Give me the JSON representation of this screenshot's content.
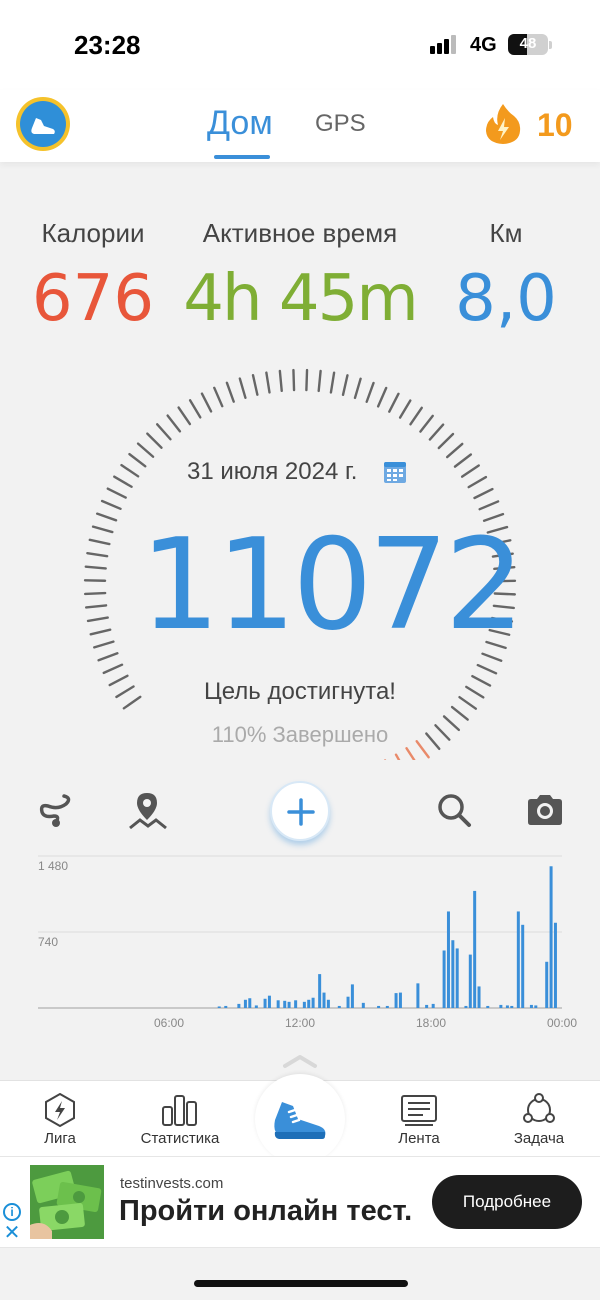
{
  "status_bar": {
    "time": "23:28",
    "network": "4G",
    "battery": "48",
    "battery_level": 0.48
  },
  "top_nav": {
    "tabs": [
      "Дом",
      "GPS"
    ],
    "active_tab": "Дом",
    "streak_count": "10",
    "accent": "#3a8fd9",
    "streak_color": "#f39a1d"
  },
  "stats": {
    "calories_label": "Калории",
    "calories_value": "676",
    "active_label": "Активное время",
    "active_value": "4h 45m",
    "distance_label": "Км",
    "distance_value": "8,0",
    "colors": {
      "calories": "#e8563a",
      "active": "#7fae35",
      "distance": "#3a8fd9"
    }
  },
  "dial": {
    "date": "31 июля 2024 г.",
    "steps": "11072",
    "goal_text": "Цель достигнута!",
    "percent_text": "110% Завершено",
    "progress": 1.1
  },
  "toolbar": {
    "icons": [
      "route-icon",
      "map-pin-icon",
      "plus-icon",
      "search-icon",
      "camera-icon"
    ]
  },
  "chart_data": {
    "type": "bar",
    "x_tick_labels": [
      "06:00",
      "12:00",
      "18:00",
      "00:00"
    ],
    "y_tick_labels": [
      "1 480",
      "740"
    ],
    "ylim": [
      0,
      1480
    ],
    "xlim": [
      0,
      24
    ],
    "color": "#3a8fd9",
    "bars": [
      {
        "x": 8.3,
        "y": 15
      },
      {
        "x": 8.6,
        "y": 20
      },
      {
        "x": 9.2,
        "y": 40
      },
      {
        "x": 9.5,
        "y": 80
      },
      {
        "x": 9.7,
        "y": 95
      },
      {
        "x": 10.0,
        "y": 25
      },
      {
        "x": 10.4,
        "y": 90
      },
      {
        "x": 10.6,
        "y": 120
      },
      {
        "x": 11.0,
        "y": 75
      },
      {
        "x": 11.3,
        "y": 70
      },
      {
        "x": 11.5,
        "y": 60
      },
      {
        "x": 11.8,
        "y": 75
      },
      {
        "x": 12.2,
        "y": 60
      },
      {
        "x": 12.4,
        "y": 80
      },
      {
        "x": 12.6,
        "y": 100
      },
      {
        "x": 12.9,
        "y": 330
      },
      {
        "x": 13.1,
        "y": 150
      },
      {
        "x": 13.3,
        "y": 80
      },
      {
        "x": 13.8,
        "y": 20
      },
      {
        "x": 14.2,
        "y": 110
      },
      {
        "x": 14.4,
        "y": 230
      },
      {
        "x": 14.9,
        "y": 50
      },
      {
        "x": 15.6,
        "y": 20
      },
      {
        "x": 16.0,
        "y": 20
      },
      {
        "x": 16.4,
        "y": 145
      },
      {
        "x": 16.6,
        "y": 150
      },
      {
        "x": 17.4,
        "y": 240
      },
      {
        "x": 17.8,
        "y": 30
      },
      {
        "x": 18.1,
        "y": 40
      },
      {
        "x": 18.6,
        "y": 560
      },
      {
        "x": 18.8,
        "y": 940
      },
      {
        "x": 19.0,
        "y": 660
      },
      {
        "x": 19.2,
        "y": 580
      },
      {
        "x": 19.6,
        "y": 20
      },
      {
        "x": 19.8,
        "y": 520
      },
      {
        "x": 20.0,
        "y": 1140
      },
      {
        "x": 20.2,
        "y": 210
      },
      {
        "x": 20.6,
        "y": 20
      },
      {
        "x": 21.2,
        "y": 30
      },
      {
        "x": 21.5,
        "y": 25
      },
      {
        "x": 21.7,
        "y": 20
      },
      {
        "x": 22.0,
        "y": 940
      },
      {
        "x": 22.2,
        "y": 810
      },
      {
        "x": 22.6,
        "y": 30
      },
      {
        "x": 22.8,
        "y": 25
      },
      {
        "x": 23.3,
        "y": 450
      },
      {
        "x": 23.5,
        "y": 1380
      },
      {
        "x": 23.7,
        "y": 830
      }
    ]
  },
  "bottom_nav": {
    "items": [
      {
        "label": "Лига",
        "icon": "lightning-hex-icon"
      },
      {
        "label": "Статистика",
        "icon": "bar-chart-icon"
      },
      {
        "label": "",
        "icon": "shoe-icon"
      },
      {
        "label": "Лента",
        "icon": "feed-icon"
      },
      {
        "label": "Задача",
        "icon": "task-icon"
      }
    ]
  },
  "ad": {
    "domain": "testinvests.com",
    "title": "Пройти онлайн тест.",
    "cta": "Подробнее"
  }
}
